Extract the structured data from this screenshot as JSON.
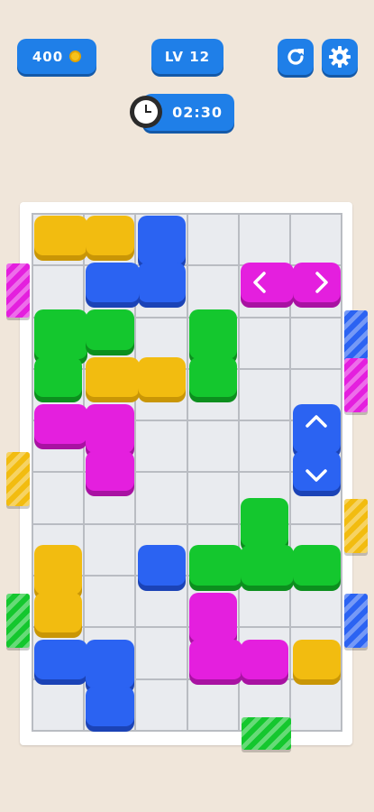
{
  "hud": {
    "coins": "400",
    "level": "LV 12",
    "timer": "02:30"
  },
  "icons": {
    "coin": "coin-icon",
    "restart": "restart-icon",
    "settings": "gear-icon",
    "clock": "clock-icon"
  },
  "colors": {
    "hud_blue": "#1f7fe8",
    "yellow": "#f2bc10",
    "blue": "#2b63f2",
    "green": "#14c72e",
    "magenta": "#e41fde",
    "background": "#f0e6da"
  },
  "board": {
    "columns": 6,
    "rows": 10,
    "blocks": [
      {
        "color": "yellow",
        "cells": [
          [
            0,
            0
          ],
          [
            1,
            0
          ]
        ]
      },
      {
        "color": "blue",
        "cells": [
          [
            2,
            0
          ],
          [
            2,
            1
          ],
          [
            1,
            1
          ]
        ]
      },
      {
        "color": "magenta",
        "cells": [
          [
            4,
            1
          ],
          [
            5,
            1
          ]
        ],
        "selected": true
      },
      {
        "color": "green",
        "cells": [
          [
            0,
            2
          ],
          [
            1,
            2
          ],
          [
            0,
            3
          ]
        ]
      },
      {
        "color": "yellow",
        "cells": [
          [
            1,
            3
          ],
          [
            2,
            3
          ]
        ]
      },
      {
        "color": "green",
        "cells": [
          [
            3,
            2
          ],
          [
            3,
            3
          ]
        ]
      },
      {
        "color": "magenta",
        "cells": [
          [
            0,
            4
          ],
          [
            1,
            4
          ],
          [
            1,
            5
          ]
        ]
      },
      {
        "color": "blue",
        "cells": [
          [
            5,
            4
          ],
          [
            5,
            5
          ]
        ],
        "selected": true
      },
      {
        "color": "green",
        "cells": [
          [
            4,
            6
          ],
          [
            3,
            7
          ],
          [
            4,
            7
          ],
          [
            5,
            7
          ]
        ]
      },
      {
        "color": "yellow",
        "cells": [
          [
            0,
            7
          ],
          [
            0,
            8
          ]
        ]
      },
      {
        "color": "blue",
        "cells": [
          [
            2,
            7
          ]
        ]
      },
      {
        "color": "magenta",
        "cells": [
          [
            3,
            8
          ],
          [
            3,
            9
          ],
          [
            4,
            9
          ]
        ]
      },
      {
        "color": "blue",
        "cells": [
          [
            0,
            9
          ],
          [
            1,
            9
          ],
          [
            1,
            10
          ]
        ]
      },
      {
        "color": "yellow",
        "cells": [
          [
            5,
            9
          ]
        ]
      }
    ],
    "exits": [
      {
        "color": "magenta",
        "side": "left",
        "row": 1
      },
      {
        "color": "yellow",
        "side": "left",
        "row": 5
      },
      {
        "color": "green",
        "side": "left",
        "row": 8
      },
      {
        "color": "blue",
        "side": "right",
        "row": 2
      },
      {
        "color": "magenta",
        "side": "right",
        "row": 3
      },
      {
        "color": "yellow",
        "side": "right",
        "row": 6
      },
      {
        "color": "blue",
        "side": "right",
        "row": 8
      },
      {
        "color": "green",
        "side": "bottom",
        "col": 4
      }
    ]
  }
}
